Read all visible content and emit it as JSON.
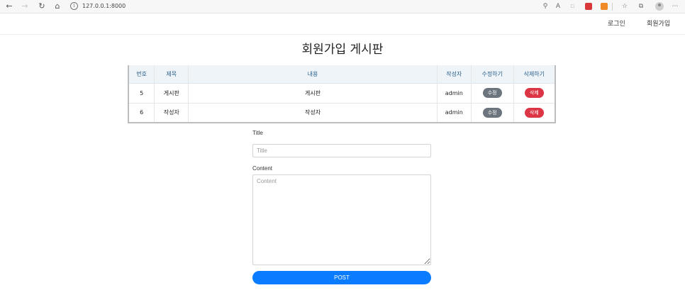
{
  "browser": {
    "url": "127.0.0.1:8000",
    "icons": [
      "back-icon",
      "forward-icon",
      "reload-icon",
      "home-icon",
      "info-icon",
      "zoom-icon",
      "read-aloud-icon",
      "favorite-icon",
      "collections-icon",
      "profile-avatar",
      "more-icon"
    ]
  },
  "nav": {
    "login": "로그인",
    "signup": "회원가입"
  },
  "page": {
    "title": "회원가입 게시판"
  },
  "table": {
    "headers": [
      "번호",
      "제목",
      "내용",
      "작성자",
      "수정하기",
      "삭제하기"
    ],
    "rows": [
      {
        "no": "5",
        "title": "게시판",
        "content": "게시판",
        "author": "admin",
        "edit": "수정",
        "delete": "삭제"
      },
      {
        "no": "6",
        "title": "작성자",
        "content": "작성자",
        "author": "admin",
        "edit": "수정",
        "delete": "삭제"
      }
    ]
  },
  "form": {
    "title_label": "Title",
    "title_placeholder": "Title",
    "content_label": "Content",
    "content_placeholder": "Content",
    "post_label": "POST"
  },
  "colors": {
    "header_bg": "#eef4f8",
    "header_text": "#2b5f8c",
    "edit_pill": "#6c757d",
    "delete_pill": "#dc3545",
    "post_button": "#0a7cff"
  }
}
